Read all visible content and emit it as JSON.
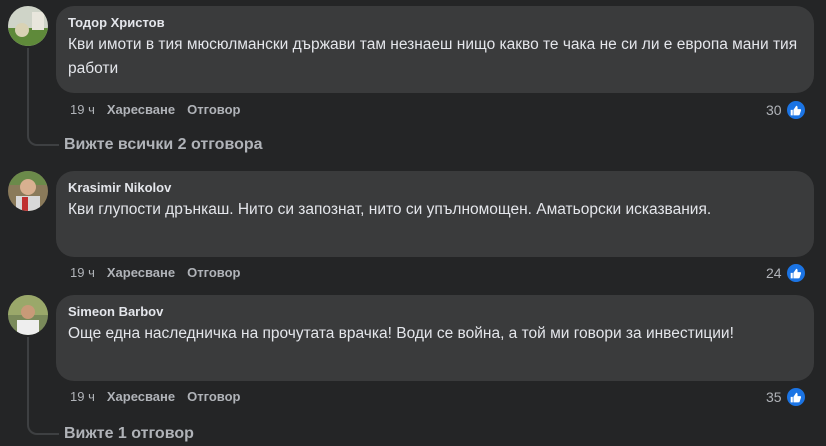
{
  "comments": [
    {
      "author": "Тодор Христов",
      "text": "Кви имоти в тия мюсюлмански държави там незнаеш нищо какво те чака не си ли е европа мани тия работи",
      "time": "19 ч",
      "like_label": "Харесване",
      "reply_label": "Отговор",
      "reactions": "30"
    },
    {
      "author": "Krasimir Nikolov",
      "text": "Кви глупости дрънкаш. Нито си запознат, нито си упълномощен. Аматьорски исказвания.",
      "time": "19 ч",
      "like_label": "Харесване",
      "reply_label": "Отговор",
      "reactions": "24"
    },
    {
      "author": "Simeon Barbov",
      "text": "Още една наследничка на прочутата врачка! Води се война, а той ми говори за инвестиции!",
      "time": "19 ч",
      "like_label": "Харесване",
      "reply_label": "Отговор",
      "reactions": "35"
    }
  ],
  "view_replies": [
    "Вижте всички 2 отговора",
    "Вижте 1 отговор"
  ],
  "colors": {
    "background": "#242526",
    "bubble": "#3a3b3c",
    "like_blue": "#1b74e4",
    "muted_text": "#b0b3b8"
  }
}
